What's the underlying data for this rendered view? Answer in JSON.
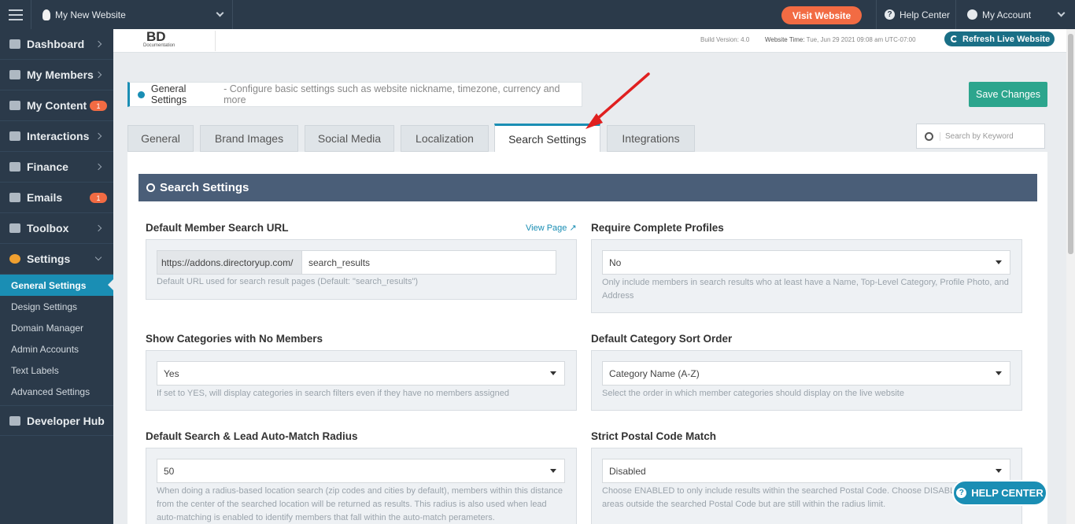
{
  "topbar": {
    "site_name": "My New Website",
    "visit_label": "Visit Website",
    "help_label": "Help Center",
    "account_label": "My Account"
  },
  "sidebar": {
    "items": [
      {
        "label": "Dashboard",
        "badge": ""
      },
      {
        "label": "My Members",
        "badge": ""
      },
      {
        "label": "My Content",
        "badge": "1"
      },
      {
        "label": "Interactions",
        "badge": ""
      },
      {
        "label": "Finance",
        "badge": ""
      },
      {
        "label": "Emails",
        "badge": "1"
      },
      {
        "label": "Toolbox",
        "badge": ""
      },
      {
        "label": "Settings",
        "badge": ""
      }
    ],
    "sub_items": [
      "General Settings",
      "Design Settings",
      "Domain Manager",
      "Admin Accounts",
      "Text Labels",
      "Advanced Settings"
    ],
    "developer": "Developer Hub"
  },
  "header": {
    "logo_text": "BD",
    "logo_sub": "Documentation",
    "build": "Build Version: 4.0",
    "time_label": "Website Time:",
    "time_value": "Tue, Jun 29 2021 09:08 am UTC-07:00",
    "refresh_label": "Refresh Live Website"
  },
  "info": {
    "title": "General Settings",
    "desc": " - Configure basic settings such as website nickname, timezone, currency and more"
  },
  "save_label": "Save Changes",
  "tabs": [
    "General",
    "Brand Images",
    "Social Media",
    "Localization",
    "Search Settings",
    "Integrations"
  ],
  "search_placeholder": "Search by Keyword",
  "panel": {
    "title": "Search Settings",
    "view_page": "View Page",
    "fields": {
      "member_url": {
        "label": "Default Member Search URL",
        "prefix": "https://addons.directoryup.com/",
        "value": "search_results",
        "help": "Default URL used for search result pages (Default: \"search_results\")"
      },
      "complete_profiles": {
        "label": "Require Complete Profiles",
        "value": "No",
        "help": "Only include members in search results who at least have a Name, Top-Level Category, Profile Photo, and Address"
      },
      "show_categories": {
        "label": "Show Categories with No Members",
        "value": "Yes",
        "help": "If set to YES, will display categories in search filters even if they have no members assigned"
      },
      "sort_order": {
        "label": "Default Category Sort Order",
        "value": "Category Name (A-Z)",
        "help": "Select the order in which member categories should display on the live website"
      },
      "radius": {
        "label": "Default Search & Lead Auto-Match Radius",
        "value": "50",
        "help": "When doing a radius-based location search (zip codes and cities by default), members within this distance from the center of the searched location will be returned as results. This radius is also used when lead auto-matching is enabled to identify members that fall within the auto-match perameters."
      },
      "postal": {
        "label": "Strict Postal Code Match",
        "value": "Disabled",
        "help": "Choose ENABLED to only include results within the searched Postal Code. Choose DISABLED to include areas outside the searched Postal Code but are still within the radius limit."
      }
    }
  },
  "help_center_float": "HELP CENTER",
  "colors": {
    "sidebar": "#2b3a4a",
    "accent": "#1a8eb4",
    "orange": "#f26b43",
    "save": "#2ca58d",
    "panel_header": "#4a5e78"
  }
}
